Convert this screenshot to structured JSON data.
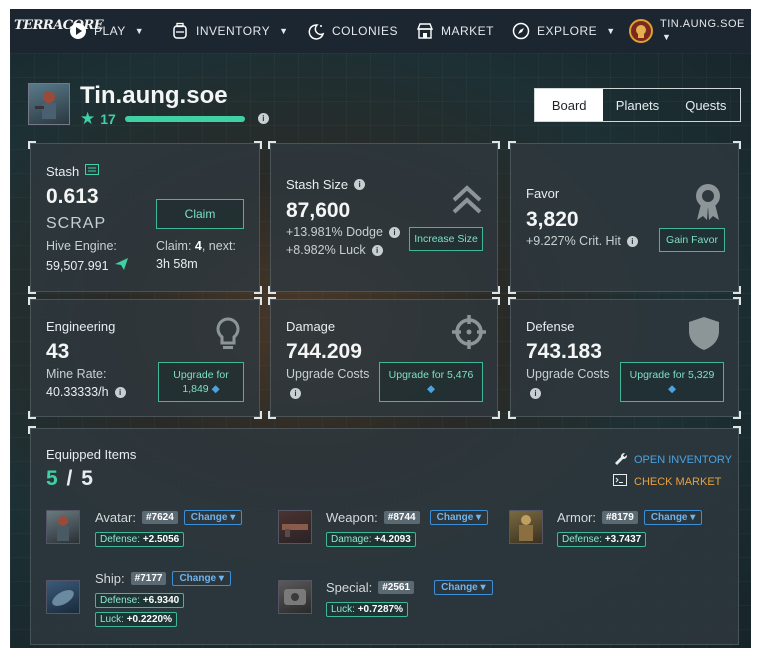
{
  "nav": {
    "logo": "TERRACORE",
    "play": "PLAY",
    "inventory": "INVENTORY",
    "colonies": "COLONIES",
    "market": "MARKET",
    "explore": "EXPLORE",
    "user": "TIN.AUNG.SOE"
  },
  "profile": {
    "name": "Tin.aung.soe",
    "level": "17",
    "xp_progress": 1.0
  },
  "tabs": [
    "Board",
    "Planets",
    "Quests"
  ],
  "stash": {
    "label": "Stash",
    "value": "0.613",
    "unit": "SCRAP",
    "hive_label": "Hive Engine:",
    "hive_value": "59,507.991",
    "claim_button": "Claim",
    "claim_label": "Claim: ",
    "claim_count": "4",
    "claim_next": ", next:",
    "claim_time": "3h 58m"
  },
  "stash_size": {
    "label": "Stash Size",
    "value": "87,600",
    "dodge": "+13.981% Dodge",
    "luck": "+8.982% Luck",
    "button": "Increase Size"
  },
  "favor": {
    "label": "Favor",
    "value": "3,820",
    "crit": "+9.227% Crit. Hit",
    "button": "Gain Favor"
  },
  "engineering": {
    "label": "Engineering",
    "value": "43",
    "rate_label": "Mine Rate:",
    "rate_value": "40.33333/h",
    "button_line1": "Upgrade for",
    "button_cost": "1,849"
  },
  "damage": {
    "label": "Damage",
    "value": "744.209",
    "costs": "Upgrade Costs",
    "button_line1": "Upgrade for",
    "button_cost": "5,476"
  },
  "defense": {
    "label": "Defense",
    "value": "743.183",
    "costs": "Upgrade Costs",
    "button_line1": "Upgrade for",
    "button_cost": "5,329"
  },
  "equipped": {
    "label": "Equipped Items",
    "count": "5",
    "sep": "/",
    "total": "5",
    "open_inventory": "OPEN INVENTORY",
    "check_market": "CHECK MARKET",
    "change": "Change",
    "items": [
      {
        "name": "Avatar:",
        "id": "#7624",
        "stat1_label": "Defense:",
        "stat1_value": "+2.5056"
      },
      {
        "name": "Weapon:",
        "id": "#8744",
        "stat1_label": "Damage:",
        "stat1_value": "+4.2093"
      },
      {
        "name": "Armor:",
        "id": "#8179",
        "stat1_label": "Defense:",
        "stat1_value": "+3.7437"
      },
      {
        "name": "Ship:",
        "id": "#7177",
        "stat1_label": "Defense:",
        "stat1_value": "+6.9340",
        "stat2_label": "Luck:",
        "stat2_value": "+0.2220%"
      },
      {
        "name": "Special:",
        "id": "#2561",
        "stat1_label": "Luck:",
        "stat1_value": "+0.7287%"
      }
    ]
  },
  "colors": {
    "accent": "#3fb89a",
    "link_blue": "#4aa3e0",
    "link_orange": "#e8a040",
    "nav_bg": "#1c2630"
  }
}
